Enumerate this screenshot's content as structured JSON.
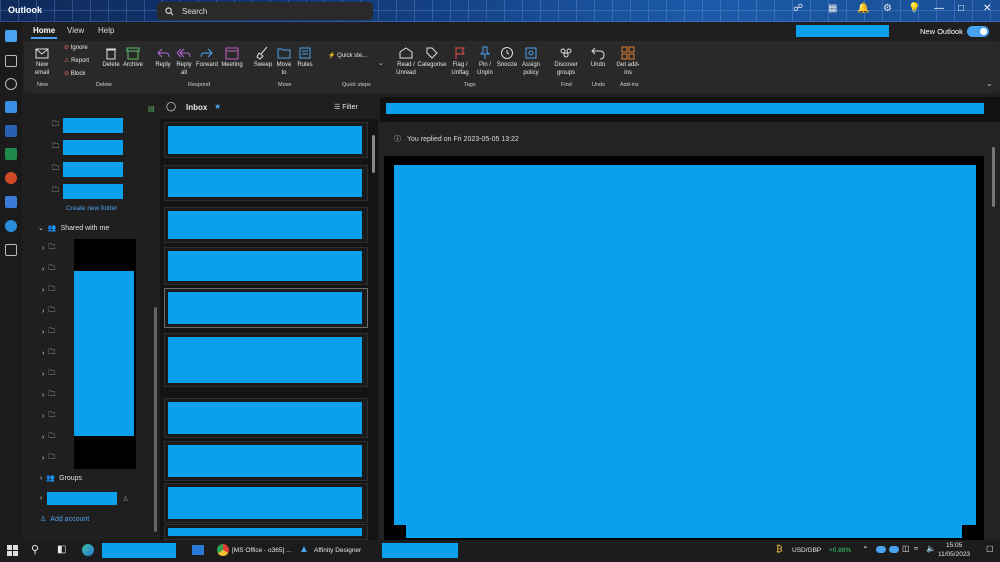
{
  "titlebar": {
    "app_title": "Outlook",
    "search_placeholder": "Search",
    "new_outlook_label": "New Outlook"
  },
  "ribbon_tabs": [
    {
      "label": "Home"
    },
    {
      "label": "View"
    },
    {
      "label": "Help"
    }
  ],
  "ribbon": {
    "new_email": "New email",
    "ignore": "Ignore",
    "report": "Report",
    "block": "Block",
    "delete": "Delete",
    "archive": "Archive",
    "reply": "Reply",
    "reply_all": "Reply all",
    "forward": "Forward",
    "meeting": "Meeting",
    "sweep": "Sweep",
    "move_to": "Move to",
    "rules": "Rules",
    "quick_steps": "Quick ste...",
    "read_unread": "Read / Unread",
    "categorise": "Categorise",
    "flag_unflag": "Flag / Unflag",
    "pin_unpin": "Pin / Unpin",
    "snooze": "Snooze",
    "assign_policy": "Assign policy",
    "discover_groups": "Discover groups",
    "undo": "Undo",
    "get_addins": "Get add-ins",
    "groups": {
      "new": "New",
      "delete": "Delete",
      "respond": "Respond",
      "move": "Move",
      "quick_steps": "Quick steps",
      "tags": "Tags",
      "find": "Find",
      "undo": "Undo",
      "addins": "Add-ins"
    }
  },
  "folders": {
    "create_new_folder": "Create new folder",
    "shared_with_me": "Shared with me",
    "groups": "Groups",
    "add_account": "Add account"
  },
  "messages": {
    "inbox_label": "Inbox",
    "filter_label": "Filter"
  },
  "reading": {
    "replied_notice": "You replied on Fri 2023-05-05 13:22"
  },
  "taskbar": {
    "chrome_label": "[MS Office - o365] ...",
    "affinity_label": "Affinity Designer",
    "ticker_symbol": "USD/GBP",
    "ticker_change": "+0.88%",
    "time": "15:05",
    "date": "11/05/2023"
  },
  "colors": {
    "accent": "#4aa3f0",
    "redaction": "#0aa0ee",
    "positive": "#3ccf6a"
  }
}
